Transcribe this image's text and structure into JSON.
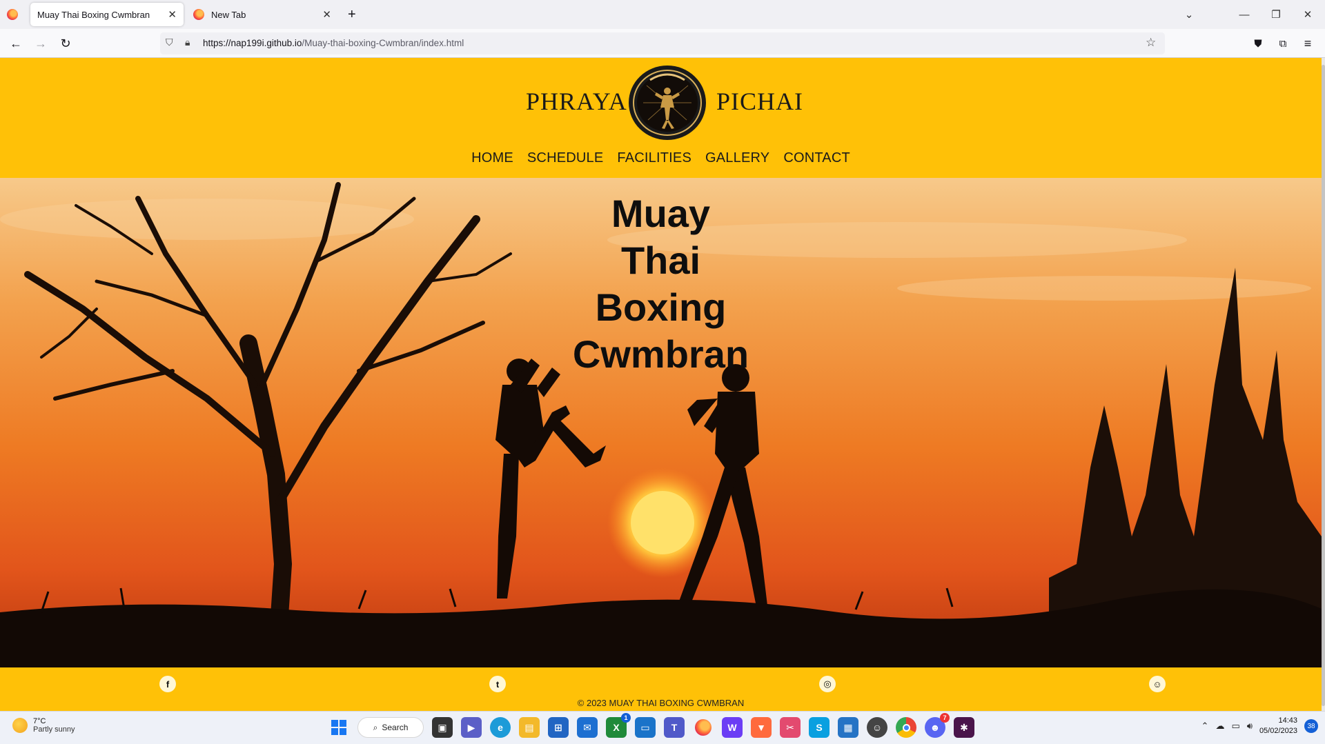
{
  "browser": {
    "tabs": [
      {
        "title": "Muay Thai Boxing Cwmbran",
        "active": true
      },
      {
        "title": "New Tab",
        "active": false
      }
    ],
    "new_tab_symbol": "+",
    "url_host": "https://nap199i.github.io",
    "url_path": "/Muay-thai-boxing-Cwmbran/index.html",
    "icons": [
      "firefox-icon",
      "close-icon",
      "plus-icon",
      "chevron-down-icon",
      "minimize-icon",
      "restore-icon",
      "window-close-icon",
      "back-icon",
      "forward-icon",
      "reload-icon",
      "shield-icon",
      "lock-icon",
      "star-icon",
      "pocket-icon",
      "extensions-icon",
      "menu-icon"
    ]
  },
  "site": {
    "brand_left": "PHRAYA",
    "brand_right": "PICHAI",
    "nav": [
      "HOME",
      "SCHEDULE",
      "FACILITIES",
      "GALLERY",
      "CONTACT"
    ],
    "hero_title_lines": [
      "Muay",
      "Thai",
      "Boxing",
      "Cwmbran"
    ],
    "social": [
      {
        "name": "facebook",
        "glyph": "f"
      },
      {
        "name": "twitter",
        "glyph": "t"
      },
      {
        "name": "instagram",
        "glyph": "◎"
      },
      {
        "name": "snapchat",
        "glyph": "☺"
      }
    ],
    "copyright_symbol": "©",
    "copyright": "2023 MUAY THAI BOXING CWMBRAN",
    "colors": {
      "header": "#ffc107",
      "text": "#1a1a1a"
    }
  },
  "taskbar": {
    "temp": "7°C",
    "weather": "Partly sunny",
    "search_label": "Search",
    "time": "14:43",
    "date": "05/02/2023",
    "notification_count": "38",
    "app_badges": {
      "xbox": "1",
      "discord": "7"
    }
  }
}
